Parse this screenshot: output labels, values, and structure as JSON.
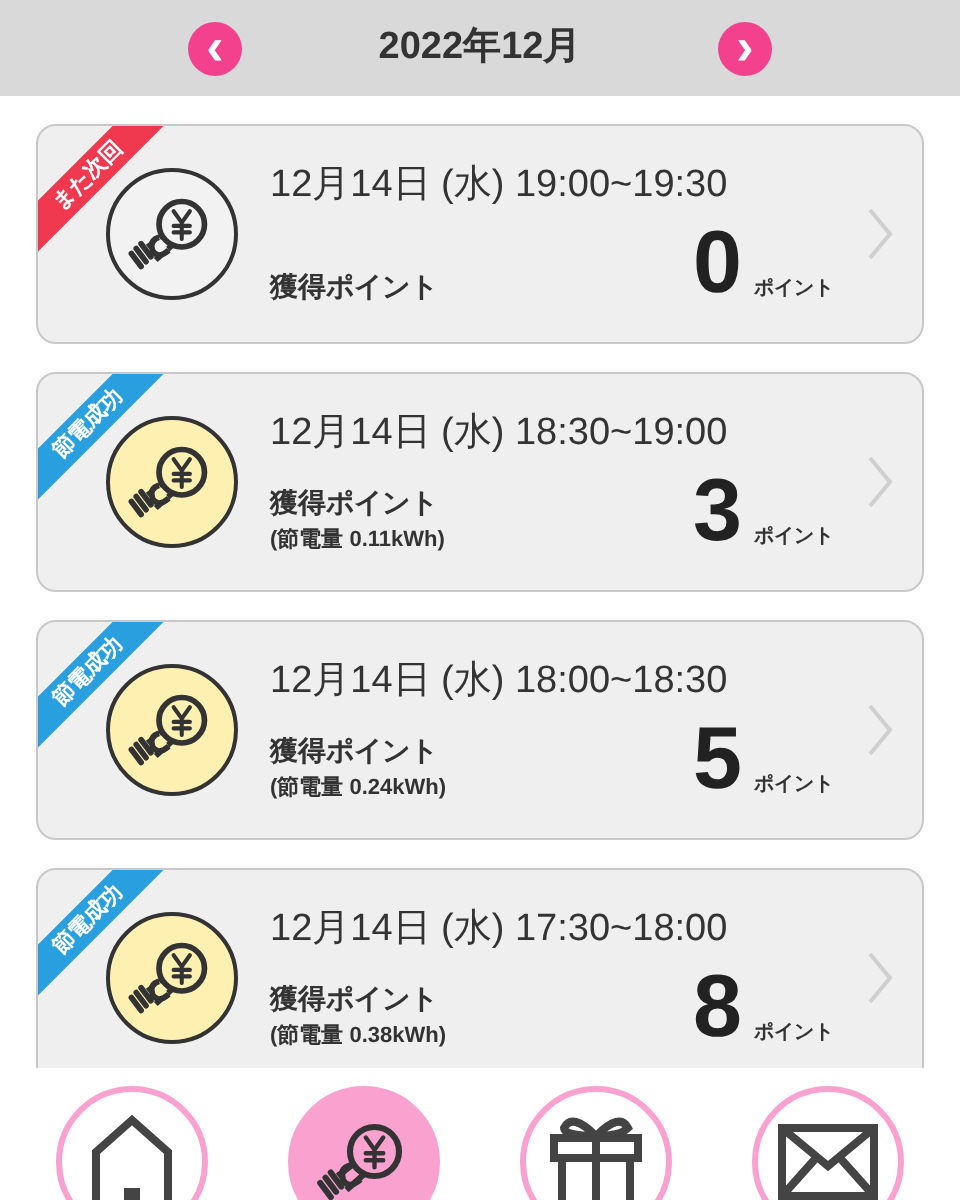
{
  "header": {
    "title": "2022年12月",
    "prev": "‹",
    "next": "›"
  },
  "records": [
    {
      "kind": "fail",
      "ribbon": "また次回",
      "datetime": "12月14日 (水) 19:00~19:30",
      "label": "獲得ポイント",
      "points": "0",
      "unit": "ポイント"
    },
    {
      "kind": "success",
      "ribbon": "節電成功",
      "datetime": "12月14日 (水) 18:30~19:00",
      "label": "獲得ポイント",
      "saving": "(節電量 0.11kWh)",
      "points": "3",
      "unit": "ポイント"
    },
    {
      "kind": "success",
      "ribbon": "節電成功",
      "datetime": "12月14日 (水) 18:00~18:30",
      "label": "獲得ポイント",
      "saving": "(節電量 0.24kWh)",
      "points": "5",
      "unit": "ポイント"
    },
    {
      "kind": "success",
      "ribbon": "節電成功",
      "datetime": "12月14日 (水) 17:30~18:00",
      "label": "獲得ポイント",
      "saving": "(節電量 0.38kWh)",
      "points": "8",
      "unit": "ポイント"
    }
  ],
  "nav": [
    {
      "kind": "home",
      "selected": false
    },
    {
      "kind": "bulb",
      "selected": true
    },
    {
      "kind": "gift",
      "selected": false
    },
    {
      "kind": "mail",
      "selected": false
    }
  ]
}
